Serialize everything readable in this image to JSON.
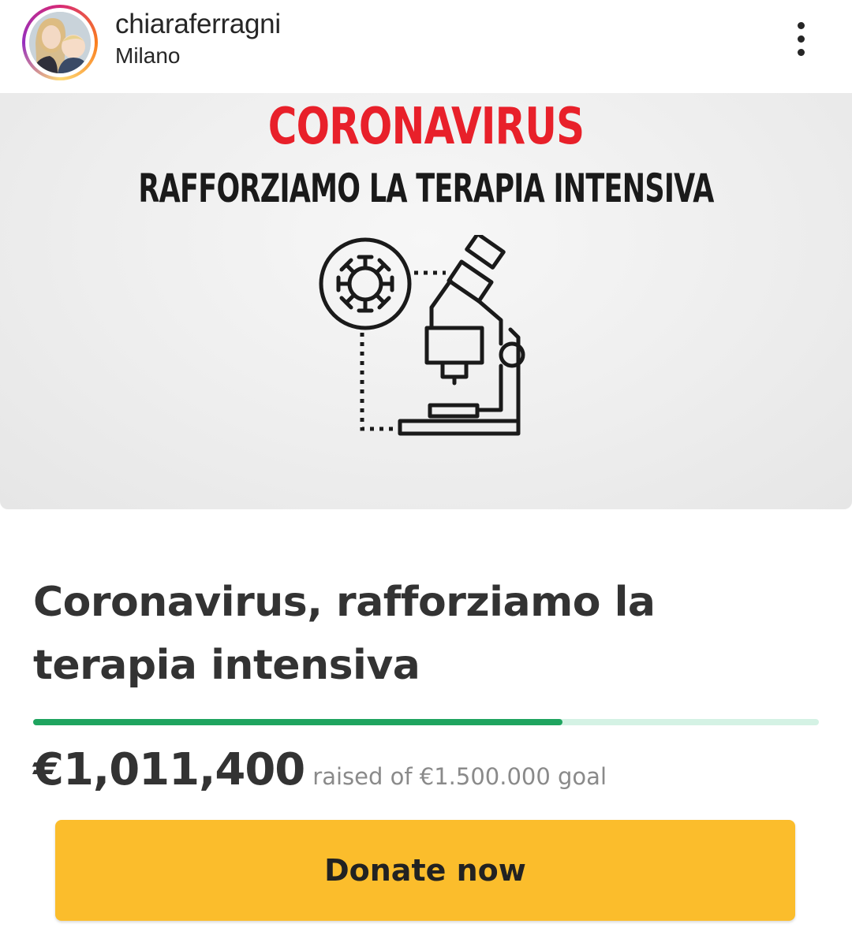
{
  "header": {
    "username": "chiaraferragni",
    "location": "Milano",
    "avatar_icon": "profile-photo-avatar",
    "more_icon": "vertical-ellipsis-icon"
  },
  "post": {
    "banner": {
      "title": "CORONAVIRUS",
      "subtitle": "RAFFORZIAMO LA TERAPIA INTENSIVA",
      "illustration_icons": [
        "virus-icon",
        "microscope-icon"
      ]
    },
    "campaign": {
      "title": "Coronavirus, rafforziamo la terapia intensiva",
      "raised": "€1,011,400",
      "goal_text": "raised of €1.500.000 goal",
      "progress_fraction": 0.674,
      "donate_label": "Donate now"
    },
    "colors": {
      "title_red": "#e8202a",
      "progress_green": "#1fa45f",
      "progress_track": "#d4f2e4",
      "donate_yellow": "#fbbd2c"
    }
  }
}
